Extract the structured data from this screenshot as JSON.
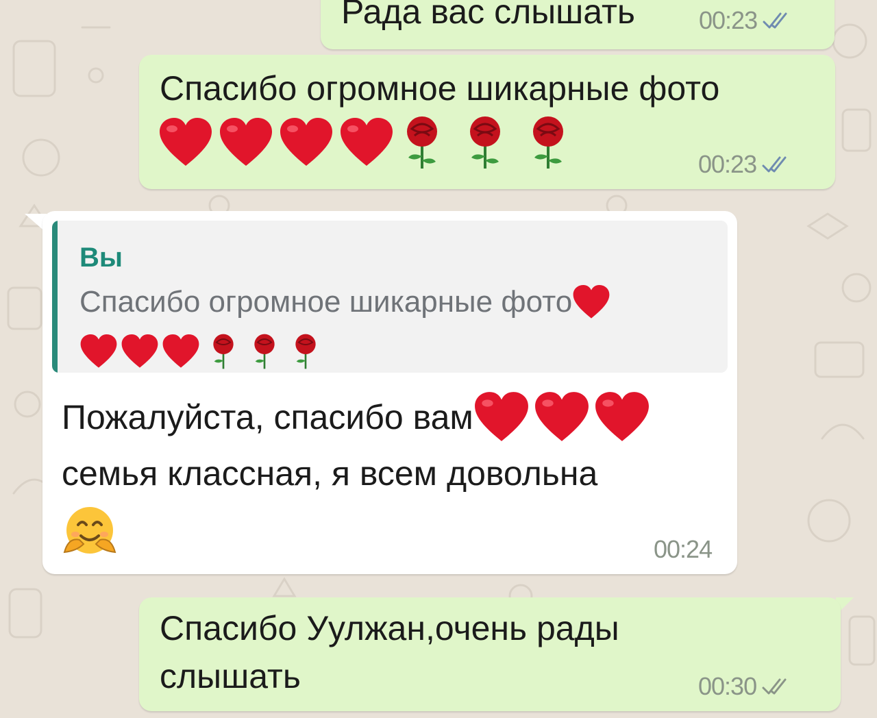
{
  "chat": {
    "messages": [
      {
        "direction": "outgoing",
        "text": "Рада вас слышать",
        "time": "00:23",
        "status_icon": "double-check-icon"
      },
      {
        "direction": "outgoing",
        "text": "Спасибо огромное шикарные фото",
        "emoji": [
          "red-heart-icon",
          "red-heart-icon",
          "red-heart-icon",
          "red-heart-icon",
          "rose-icon",
          "rose-icon",
          "rose-icon"
        ],
        "time": "00:23",
        "status_icon": "double-check-icon"
      },
      {
        "direction": "incoming",
        "reply_to": {
          "author": "Вы",
          "text": "Спасибо огромное шикарные фото",
          "emoji": [
            "red-heart-icon",
            "red-heart-icon",
            "red-heart-icon",
            "red-heart-icon",
            "rose-icon",
            "rose-icon",
            "rose-icon"
          ]
        },
        "line1": "Пожалуйста, спасибо вам",
        "line1_emoji": [
          "red-heart-icon",
          "red-heart-icon",
          "red-heart-icon"
        ],
        "line2": "семья классная, я всем довольна",
        "line3_emoji": [
          "hugging-face-icon"
        ],
        "time": "00:24"
      },
      {
        "direction": "outgoing",
        "line1": "Спасибо Уулжан,очень рады",
        "line2": "слышать",
        "time": "00:30",
        "status_icon": "double-check-icon"
      }
    ]
  },
  "colors": {
    "outgoing_bubble": "#e0f6c9",
    "incoming_bubble": "#ffffff",
    "background": "#e9e2d8",
    "quote_accent": "#2a8a7a",
    "author_name": "#1e8a79",
    "timestamp": "#8a9488",
    "heart": "#e1152b",
    "rose": "#c4121d"
  }
}
